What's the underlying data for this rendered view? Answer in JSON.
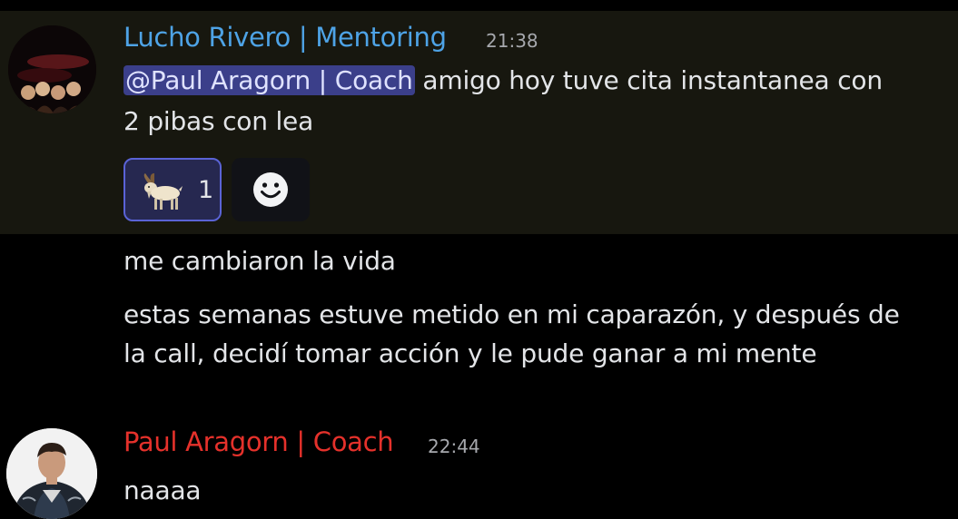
{
  "messages": [
    {
      "author": "Lucho Rivero | Mentoring",
      "time": "21:38",
      "mention": "@Paul Aragorn | Coach",
      "text_after_mention": " amigo hoy tuve cita instantanea con",
      "text_line2": "2 pibas con lea",
      "reaction": {
        "emoji": "goat",
        "count": "1"
      }
    },
    {
      "text": "me cambiaron la vida"
    },
    {
      "line1": "estas semanas estuve metido en mi caparazón, y después de",
      "line2": "la call, decidí tomar acción y le pude ganar a mi mente"
    },
    {
      "author": "Paul Aragorn | Coach",
      "time": "22:44",
      "text": "naaaa"
    }
  ],
  "colors": {
    "author_1": "#4ea3e6",
    "author_2": "#e5312b",
    "highlight_bg": "#17170f",
    "mention_bg": "#3b3f8a",
    "reaction_border": "#5a63d6"
  }
}
